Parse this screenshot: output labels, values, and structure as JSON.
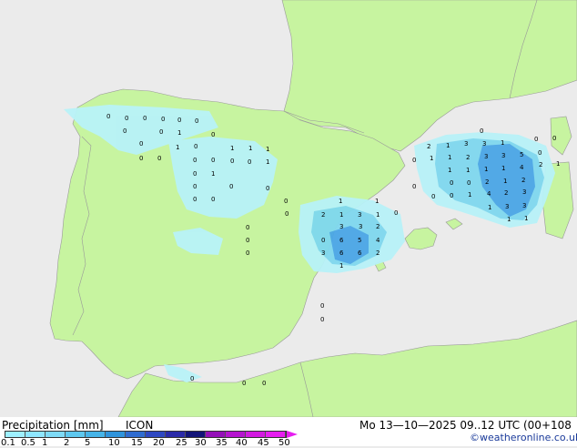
{
  "legend": {
    "title": "Precipitation [mm]",
    "model": "ICON",
    "ticks": [
      "0.1",
      "0.5",
      "1",
      "2",
      "5",
      "10",
      "15",
      "20",
      "25",
      "30",
      "35",
      "40",
      "45",
      "50"
    ],
    "colors": [
      "#9ef0ff",
      "#8ee6ff",
      "#7edaf6",
      "#5ec8ef",
      "#46b4e8",
      "#2f94dc",
      "#2f6cd0",
      "#2e48c2",
      "#2a2aa8",
      "#121478",
      "#9410b8",
      "#b514cf",
      "#d21ae0",
      "#e61ef0"
    ]
  },
  "timestamp": "Mo 13—10—2025 09..12 UTC (00+108",
  "credit": "©weatheronline.co.uk",
  "colors": {
    "sea": "#ebebeb",
    "land": "#c7f4a0",
    "border": "#888888",
    "rain_light": "#b8f2f8",
    "rain_mid": "#7fd8ef",
    "rain_heavy": "#4aa6e6"
  },
  "station_values": [
    "0",
    "1",
    "2",
    "3",
    "4",
    "5",
    "6"
  ]
}
